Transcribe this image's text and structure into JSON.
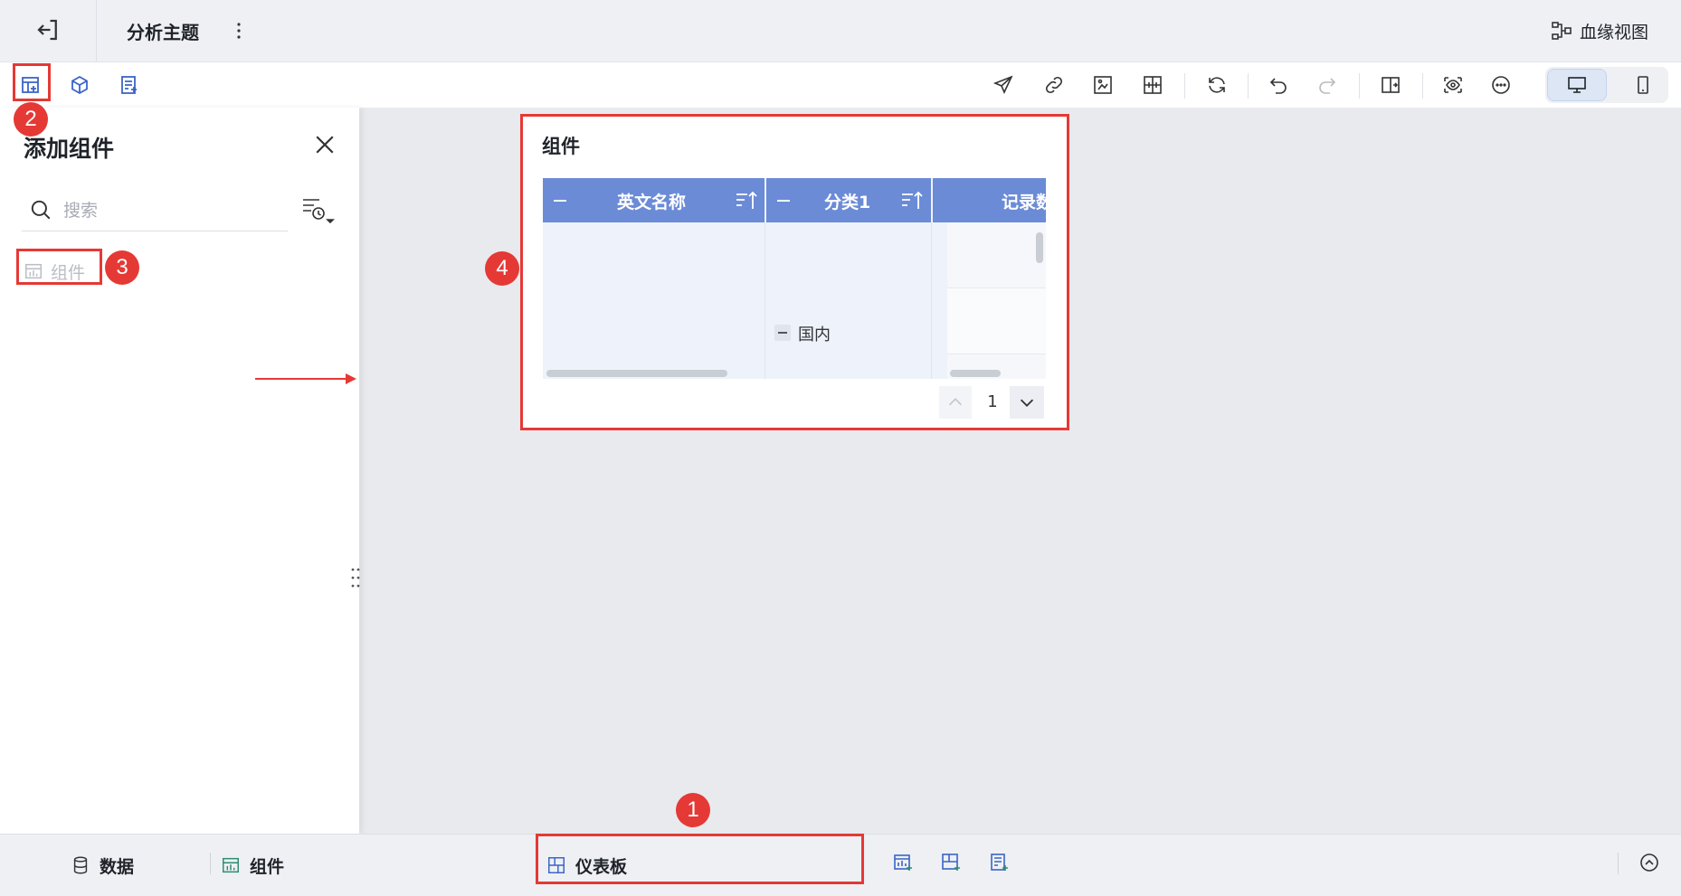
{
  "header": {
    "title": "分析主题",
    "lineage_label": "血缘视图"
  },
  "panel": {
    "title": "添加组件",
    "search": {
      "placeholder": "搜索",
      "value": ""
    },
    "items": [
      {
        "label": "组件"
      }
    ]
  },
  "widget": {
    "title": "组件",
    "columns": [
      "英文名称",
      "分类1",
      "记录数"
    ],
    "rows": [
      {
        "label": "国内"
      }
    ],
    "pagination": {
      "current_page": "1"
    }
  },
  "footer": {
    "data_tab": "数据",
    "component_tab": "组件",
    "dashboard_tab": "仪表板"
  },
  "annotations": [
    "1",
    "2",
    "3",
    "4"
  ],
  "colors": {
    "accent": "#3a64c7",
    "table_header": "#6b8bd6",
    "annotation": "#e53935"
  }
}
